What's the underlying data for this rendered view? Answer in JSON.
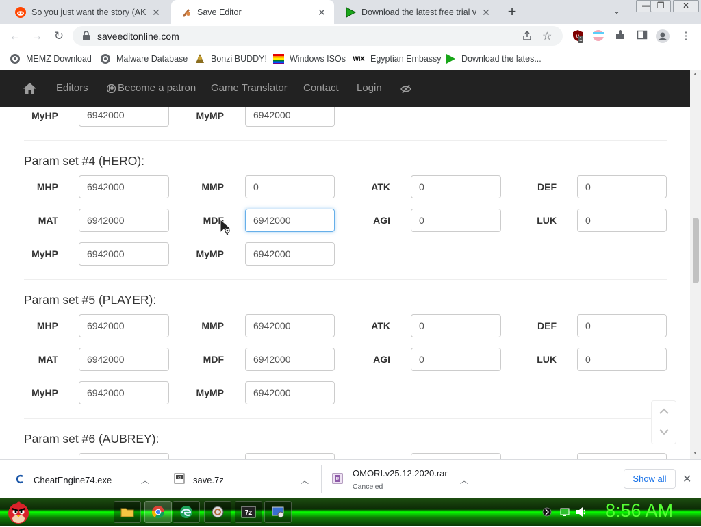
{
  "browser": {
    "tabs": [
      {
        "title": "So you just want the story (AKA l",
        "close": "✕"
      },
      {
        "title": "Save Editor",
        "close": "✕"
      },
      {
        "title": "Download the latest free trial ver",
        "close": "✕"
      }
    ],
    "newtab": "+",
    "tabmenu": "⌄",
    "window": {
      "minimize": "—",
      "maximize": "❐",
      "close": "✕"
    },
    "url": "saveeditonline.com",
    "extension_badge": "1",
    "bookmarks": [
      {
        "label": "MEMZ Download"
      },
      {
        "label": "Malware Database"
      },
      {
        "label": "Bonzi BUDDY!"
      },
      {
        "label": "Windows ISOs"
      },
      {
        "label": "Egyptian Embassy"
      },
      {
        "label": "Download the lates..."
      }
    ]
  },
  "site": {
    "nav": {
      "editors": "Editors",
      "patron": "Become a patron",
      "translator": "Game Translator",
      "contact": "Contact",
      "login": "Login"
    },
    "partial_row": {
      "myhp_label": "MyHP",
      "myhp_value": "6942000",
      "mymp_label": "MyMP",
      "mymp_value": "6942000"
    },
    "set4": {
      "title": "Param set #4 (HERO):",
      "mhp_label": "MHP",
      "mhp": "6942000",
      "mmp_label": "MMP",
      "mmp": "0",
      "atk_label": "ATK",
      "atk": "0",
      "def_label": "DEF",
      "def": "0",
      "mat_label": "MAT",
      "mat": "6942000",
      "mdf_label": "MDF",
      "mdf": "6942000",
      "agi_label": "AGI",
      "agi": "0",
      "luk_label": "LUK",
      "luk": "0",
      "myhp_label": "MyHP",
      "myhp": "6942000",
      "mymp_label": "MyMP",
      "mymp": "6942000"
    },
    "set5": {
      "title": "Param set #5 (PLAYER):",
      "mhp_label": "MHP",
      "mhp": "6942000",
      "mmp_label": "MMP",
      "mmp": "6942000",
      "atk_label": "ATK",
      "atk": "0",
      "def_label": "DEF",
      "def": "0",
      "mat_label": "MAT",
      "mat": "6942000",
      "mdf_label": "MDF",
      "mdf": "6942000",
      "agi_label": "AGI",
      "agi": "0",
      "luk_label": "LUK",
      "luk": "0",
      "myhp_label": "MyHP",
      "myhp": "6942000",
      "mymp_label": "MyMP",
      "mymp": "6942000"
    },
    "set6": {
      "title": "Param set #6 (AUBREY):"
    }
  },
  "downloads": {
    "items": [
      {
        "name": "CheatEngine74.exe",
        "status": ""
      },
      {
        "name": "save.7z",
        "status": ""
      },
      {
        "name": "OMORI.v25.12.2020.rar",
        "status": "Canceled"
      }
    ],
    "show_all": "Show all",
    "close": "✕"
  },
  "taskbar": {
    "clock": "8:56 AM"
  },
  "colors": {
    "nav_bg": "#222222",
    "nav_link": "#9d9d9d",
    "focus_border": "#66afe9",
    "clock": "#55ff33",
    "link_blue": "#1a73e8"
  }
}
